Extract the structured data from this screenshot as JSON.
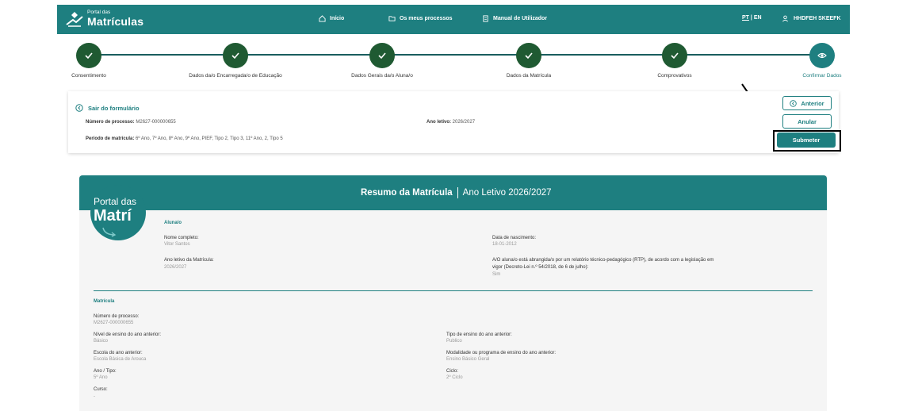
{
  "header": {
    "logo_small": "Portal das",
    "logo_big": "Matrículas",
    "nav": [
      {
        "label": "Início",
        "icon": "home-icon"
      },
      {
        "label": "Os meus processos",
        "icon": "folder-icon"
      },
      {
        "label": "Manual de Utilizador",
        "icon": "document-icon"
      }
    ],
    "lang_pt": "PT",
    "lang_sep": "|",
    "lang_en": "EN",
    "user_name": "HHDFEH SKEEFK"
  },
  "stepper": {
    "steps": [
      {
        "label": "Consentimento",
        "state": "done"
      },
      {
        "label": "Dados da/o Encarregada/o de Educação",
        "state": "done"
      },
      {
        "label": "Dados Gerais da/o Aluna/o",
        "state": "done"
      },
      {
        "label": "Dados da Matrícula",
        "state": "done"
      },
      {
        "label": "Comprovativos",
        "state": "done"
      },
      {
        "label": "Confirmar Dados",
        "state": "current"
      }
    ],
    "done_color": "#1f5a32",
    "current_color": "#1e7f80"
  },
  "form_card": {
    "exit_label": "Sair do formulário",
    "process_label": "Número de processo:",
    "process_value": "M2627-000000655",
    "year_label": "Ano letivo:",
    "year_value": "2026/2027",
    "period_label": "Período de matrícula:",
    "period_value": "6º Ano, 7º Ano, 8º Ano, 9º Ano, PIEF, Tipo 2, Tipo 3, 11º Ano, 2, Tipo 5",
    "btn_previous": "Anterior",
    "btn_cancel": "Anular",
    "btn_submit": "Submeter"
  },
  "summary": {
    "title_strong": "Resumo da Matrícula",
    "title_year": "Ano Letivo 2026/2027",
    "watermark_small": "Portal das",
    "watermark_big": "Matrí",
    "student_section": "Aluna/o",
    "student": {
      "name_label": "Nome completo:",
      "name_value": "Vitor Santos",
      "birth_label": "Data de nascimento:",
      "birth_value": "18-01-2012",
      "year_label": "Ano letivo da Matrícula:",
      "year_value": "2026/2027",
      "rtp_label_1": "A/O aluna/o está abrangida/o por um relatório técnico-pedagógico (RTP), de acordo com a legislação em",
      "rtp_label_2": "vigor (Decreto-Lei n.º 54/2018, de 6 de julho):",
      "rtp_value": "Sim"
    },
    "enrollment_section": "Matrícula",
    "enrollment": {
      "process_label": "Número de processo:",
      "process_value": "M2627-000000655",
      "level_label": "Nível de ensino do ano anterior:",
      "level_value": "Básico",
      "type_label": "Tipo de ensino do ano anterior:",
      "type_value": "Publico",
      "school_label": "Escola do ano anterior:",
      "school_value": "Escola Básica de Arouca",
      "modality_label": "Modalidade ou programa de ensino do ano anterior:",
      "modality_value": "Ensino Básico Geral",
      "grade_label": "Ano / Tipo:",
      "grade_value": "5º Ano",
      "cycle_label": "Ciclo:",
      "cycle_value": "2º Ciclo",
      "course_label": "Curso:",
      "course_value": "-"
    }
  },
  "colors": {
    "brand": "#1e7f80",
    "panel_bg": "#f5f5f5"
  }
}
